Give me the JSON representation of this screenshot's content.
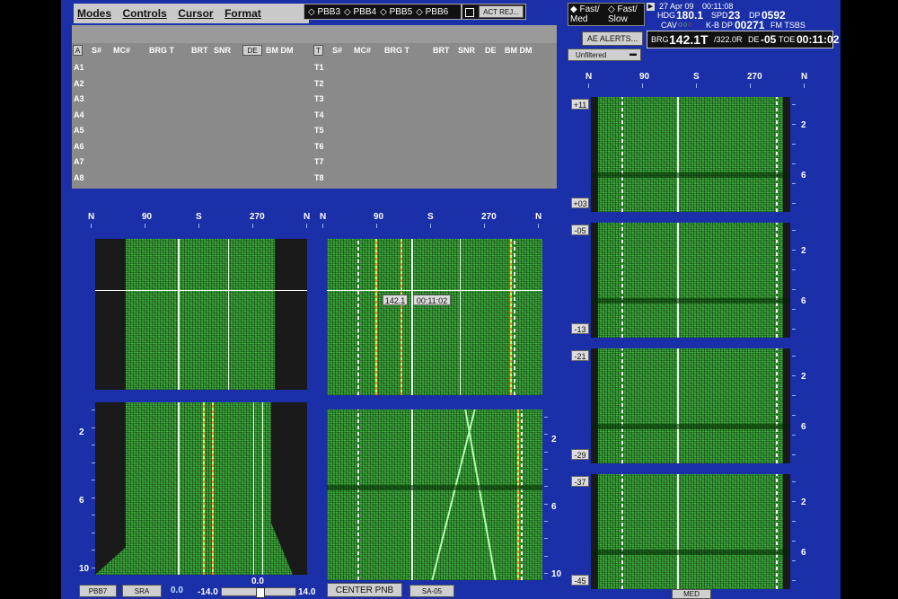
{
  "menu": {
    "modes": "Modes",
    "controls": "Controls",
    "cursor": "Cursor",
    "format": "Format"
  },
  "pbb": [
    "PBB3",
    "PBB4",
    "PBB5",
    "PBB6"
  ],
  "act_rej": "ACT REJ...",
  "speed": {
    "fast_med": "Fast/ Med",
    "fast_slow": "Fast/ Slow"
  },
  "nav": {
    "date": "27 Apr 09",
    "time": "00:11:08",
    "hdg_label": "HDG",
    "hdg": "180.1",
    "spd_label": "SPD",
    "spd": "23",
    "dp_label": "DP",
    "dp": "0592",
    "cav_label": "CAV",
    "kb_dp_label": "K-B DP",
    "kb_dp": "00271",
    "fm_label": "FM TSBS"
  },
  "ae_alerts": "AE ALERTS...",
  "brg": {
    "brg_label": "BRG",
    "brg": "142.1T",
    "range": "/322.0R",
    "de_label": "DE",
    "de": "-05",
    "toe_label": "TOE",
    "toe": "00:11:02"
  },
  "filter": "Unfiltered",
  "table": {
    "a_headers": [
      "A",
      "S#",
      "MC#",
      "BRG T",
      "BRT",
      "SNR",
      "DE",
      "BM DM"
    ],
    "t_headers": [
      "T",
      "S#",
      "MC#",
      "BRG T",
      "BRT",
      "SNR",
      "DE",
      "BM DM"
    ],
    "a_rows": [
      "A1",
      "A2",
      "A3",
      "A4",
      "A5",
      "A6",
      "A7",
      "A8"
    ],
    "t_rows": [
      "T1",
      "T2",
      "T3",
      "T4",
      "T5",
      "T6",
      "T7",
      "T8"
    ]
  },
  "bearing_axis": [
    "N",
    "90",
    "S",
    "270",
    "N"
  ],
  "left_time_ticks": [
    "2",
    "6",
    "10"
  ],
  "mid_time_ticks": [
    "2",
    "6",
    "10"
  ],
  "right_time_ticks": [
    "2",
    "6"
  ],
  "cursor_box": {
    "bearing": "142.1",
    "time": "00:11:02"
  },
  "right_panels": [
    {
      "top": "+11",
      "bottom": "+03"
    },
    {
      "top": "-05",
      "bottom": "-13"
    },
    {
      "top": "-21",
      "bottom": "-29"
    },
    {
      "top": "-37",
      "bottom": "-45"
    }
  ],
  "bottom": {
    "pbb7": "PBB7",
    "sra": "SRA",
    "val_a": "0.0",
    "val_b": "-14.0",
    "val_c": "0.0",
    "val_d": "14.0",
    "center_pnb": "CENTER PNB",
    "sa": "SA-05",
    "med": "MED"
  }
}
